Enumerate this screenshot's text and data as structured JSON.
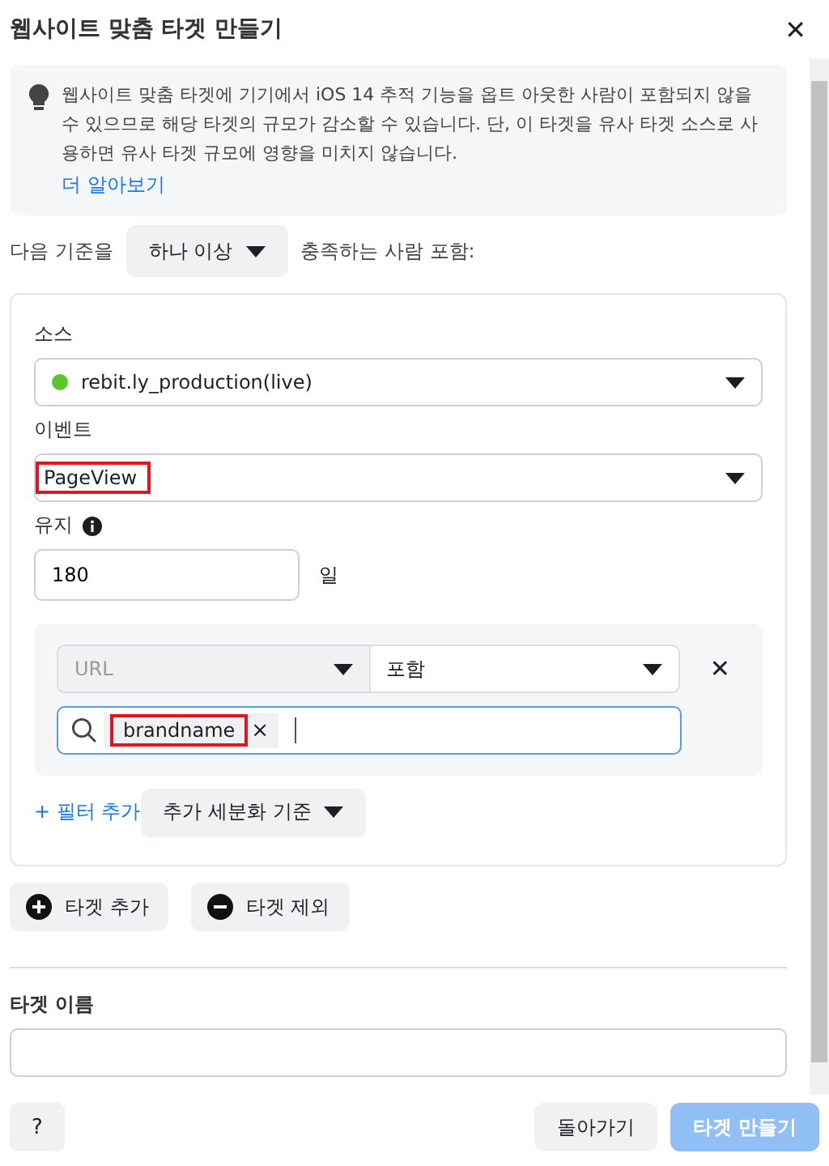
{
  "dialog": {
    "title": "웹사이트 맞춤 타겟 만들기",
    "close": "✕"
  },
  "notice": {
    "text": "웹사이트 맞춤 타겟에 기기에서 iOS 14 추적 기능을 옵트 아웃한 사람이 포함되지 않을 수 있으므로 해당 타겟의 규모가 감소할 수 있습니다. 단, 이 타겟을 유사 타겟 소스로 사용하면 유사 타겟 규모에 영향을 미치지 않습니다.",
    "link": "더 알아보기"
  },
  "criteria": {
    "prefix": "다음 기준을",
    "dropdown": "하나 이상",
    "suffix": "충족하는 사람 포함:"
  },
  "rule": {
    "source_label": "소스",
    "source": {
      "value": "rebit.ly_production(live)",
      "color": "#5ac72a"
    },
    "event_label": "이벤트",
    "event": {
      "value": "PageView",
      "highlighted": true
    },
    "retention_label": "유지",
    "retention": "180",
    "retention_unit": "일",
    "filter": {
      "field": {
        "value": "URL",
        "disabled": true
      },
      "operator": "포함",
      "remove": "✕",
      "tags": [
        {
          "text": "brandname",
          "remove": "×",
          "highlighted": true
        }
      ]
    },
    "add_filter": "+ 필터 추가",
    "refine": "추가 세분화 기준"
  },
  "actions": [
    {
      "kind": "include",
      "label": "타겟 추가"
    },
    {
      "kind": "exclude",
      "label": "타겟 제외"
    }
  ],
  "name_label": "타겟 이름",
  "footer": {
    "help": "?",
    "back": "돌아가기",
    "create": {
      "label": "타겟 만들기",
      "disabled": true
    }
  }
}
